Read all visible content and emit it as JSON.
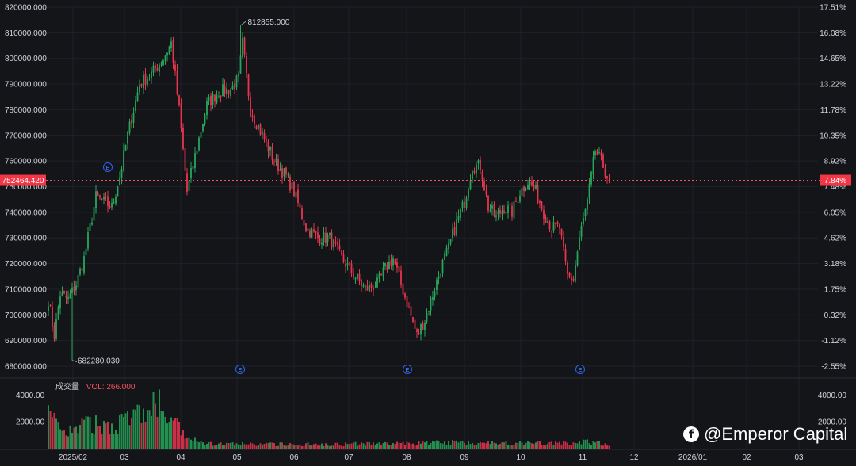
{
  "chart_data": {
    "type": "candlestick",
    "y_labels": [
      "820000.000",
      "810000.000",
      "800000.000",
      "790000.000",
      "780000.000",
      "770000.000",
      "760000.000",
      "750000.000",
      "740000.000",
      "730000.000",
      "720000.000",
      "710000.000",
      "700000.000",
      "690000.000",
      "680000.000"
    ],
    "ylim": [
      680000,
      820000
    ],
    "pct_labels": [
      "17.51%",
      "16.08%",
      "14.65%",
      "13.22%",
      "11.78%",
      "10.35%",
      "8.92%",
      "7.48%",
      "6.05%",
      "4.62%",
      "3.18%",
      "1.75%",
      "0.32%",
      "-1.12%",
      "-2.55%"
    ],
    "x_labels": [
      "2025/02",
      "03",
      "04",
      "05",
      "06",
      "07",
      "08",
      "09",
      "10",
      "11",
      "12",
      "2026/01",
      "02",
      "03"
    ],
    "current_price": 752464.42,
    "current_price_label": "752464.420",
    "current_pct_label": "7.84%",
    "high_label": "812855.000",
    "low_label": "682280.030",
    "event_marker": "E",
    "volume_labels": [
      "4000.00",
      "2000.00"
    ],
    "volume_title": "成交量",
    "volume_value_label": "VOL: 266.000",
    "anchors": [
      [
        0,
        706000
      ],
      [
        3,
        692000
      ],
      [
        6,
        708000
      ],
      [
        10,
        706000
      ],
      [
        14,
        712000
      ],
      [
        18,
        722000
      ],
      [
        24,
        746000
      ],
      [
        28,
        744000
      ],
      [
        32,
        742000
      ],
      [
        36,
        754000
      ],
      [
        40,
        770000
      ],
      [
        46,
        790000
      ],
      [
        52,
        794000
      ],
      [
        58,
        800000
      ],
      [
        62,
        806000
      ],
      [
        66,
        780000
      ],
      [
        70,
        748000
      ],
      [
        74,
        762000
      ],
      [
        80,
        782000
      ],
      [
        86,
        787000
      ],
      [
        92,
        788000
      ],
      [
        96,
        792000
      ],
      [
        98,
        806000
      ],
      [
        102,
        780000
      ],
      [
        108,
        770000
      ],
      [
        114,
        760000
      ],
      [
        120,
        754000
      ],
      [
        124,
        748000
      ],
      [
        130,
        734000
      ],
      [
        136,
        730000
      ],
      [
        142,
        730000
      ],
      [
        148,
        722000
      ],
      [
        154,
        716000
      ],
      [
        160,
        710000
      ],
      [
        166,
        712000
      ],
      [
        170,
        718000
      ],
      [
        174,
        722000
      ],
      [
        178,
        712000
      ],
      [
        182,
        702000
      ],
      [
        186,
        692000
      ],
      [
        190,
        698000
      ],
      [
        194,
        708000
      ],
      [
        198,
        718000
      ],
      [
        202,
        726000
      ],
      [
        206,
        736000
      ],
      [
        210,
        744000
      ],
      [
        214,
        758000
      ],
      [
        218,
        758000
      ],
      [
        222,
        742000
      ],
      [
        226,
        738000
      ],
      [
        230,
        742000
      ],
      [
        234,
        740000
      ],
      [
        238,
        748000
      ],
      [
        242,
        752000
      ],
      [
        246,
        748000
      ],
      [
        250,
        740000
      ],
      [
        254,
        734000
      ],
      [
        258,
        734000
      ],
      [
        260,
        724000
      ],
      [
        262,
        715000
      ],
      [
        265,
        714000
      ],
      [
        268,
        730000
      ],
      [
        272,
        744000
      ],
      [
        276,
        764000
      ],
      [
        280,
        758000
      ],
      [
        283,
        752000
      ]
    ],
    "volume_anchors": [
      [
        0,
        2300
      ],
      [
        10,
        1300
      ],
      [
        20,
        1800
      ],
      [
        30,
        1700
      ],
      [
        40,
        2200
      ],
      [
        50,
        2800
      ],
      [
        56,
        3300
      ],
      [
        62,
        1900
      ],
      [
        66,
        1500
      ],
      [
        70,
        700
      ],
      [
        80,
        350
      ],
      [
        100,
        330
      ],
      [
        140,
        330
      ],
      [
        180,
        370
      ],
      [
        200,
        460
      ],
      [
        220,
        450
      ],
      [
        240,
        400
      ],
      [
        260,
        410
      ],
      [
        270,
        530
      ],
      [
        283,
        300
      ]
    ],
    "num_days": 284
  }
}
